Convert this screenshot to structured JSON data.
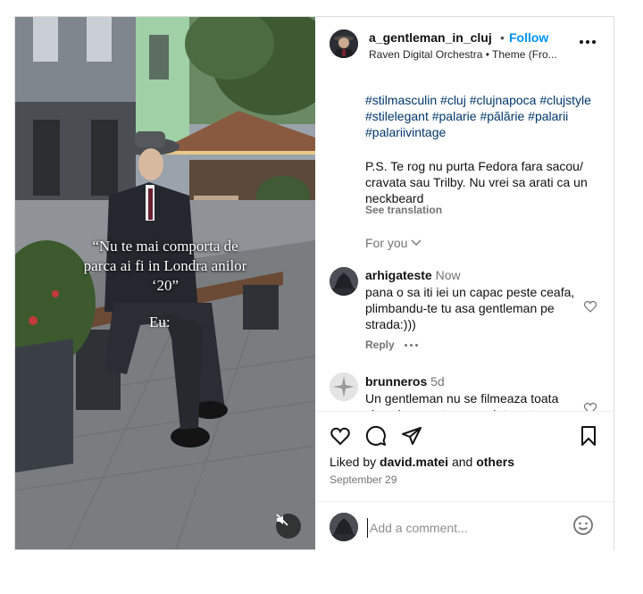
{
  "post": {
    "overlay_lines": [
      "“Nu te mai comporta de",
      "parca ai fi in Londra anilor",
      "‘20”"
    ],
    "overlay_eu": "Eu:"
  },
  "header": {
    "username": "a_gentleman_in_cluj",
    "separator": "•",
    "follow_label": "Follow",
    "subtitle": "Raven Digital Orchestra • Theme (Fro..."
  },
  "caption": {
    "hashtags": [
      "#stilmasculin",
      "#cluj",
      "#clujnapoca",
      "#clujstyle",
      "#stilelegant",
      "#palarie",
      "#pălărie",
      "#palarii",
      "#palariivintage"
    ],
    "ps_text": "P.S. Te rog nu purta Fedora fara sacou/ cravata sau Trilby. Nu vrei sa arati ca un neckbeard",
    "see_translation": "See translation",
    "for_you": "For you"
  },
  "comments": [
    {
      "username": "arhigateste",
      "time": "Now",
      "text": "pana o sa iti iei un capac peste ceafa, plimbandu-te tu asa gentleman pe strada:)))",
      "reply_label": "Reply"
    },
    {
      "username": "brunneros",
      "time": "5d",
      "text": "Un gentleman nu se filmeaza toata ziua si nu posteaza pe internet"
    }
  ],
  "footer": {
    "liked_prefix": "Liked by ",
    "liked_user": "david.matei",
    "liked_and": " and ",
    "liked_others": "others",
    "date": "September 29",
    "add_comment_placeholder": "Add a comment..."
  },
  "icons": {
    "like": "heart-icon",
    "comment": "comment-icon",
    "share": "paper-plane-icon",
    "save": "bookmark-icon",
    "emoji": "smiley-icon",
    "mute": "speaker-muted-icon",
    "more": "more-options-icon"
  },
  "colors": {
    "link": "#0095f6",
    "hashtag": "#00376b",
    "muted_text": "#737373",
    "border": "#dbdbdb"
  }
}
